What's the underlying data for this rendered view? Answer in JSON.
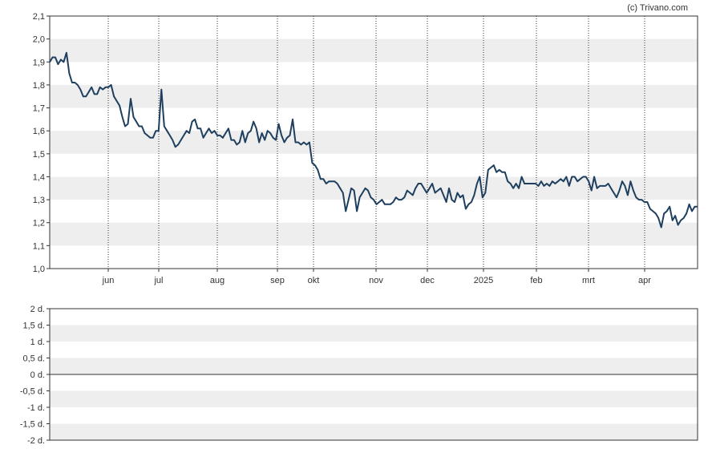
{
  "copyright": "(c) Trivano.com",
  "chart_data": [
    {
      "type": "line",
      "title": "",
      "xlabel": "",
      "ylabel": "",
      "ylim": [
        1.0,
        2.1
      ],
      "grid": "alternating horizontal bands, dotted vertical month lines",
      "line_color": "#1f3f5f",
      "band_color": "#eeeeee",
      "x_ticks": [
        "jun",
        "jul",
        "aug",
        "sep",
        "okt",
        "nov",
        "dec",
        "2025",
        "feb",
        "mrt",
        "apr"
      ],
      "y_ticks": [
        "1,0",
        "1,1",
        "1,2",
        "1,3",
        "1,4",
        "1,5",
        "1,6",
        "1,7",
        "1,8",
        "1,9",
        "2,0",
        "2,1"
      ],
      "series": [
        {
          "values": [
            1.9,
            1.92,
            1.92,
            1.89,
            1.91,
            1.9,
            1.94,
            1.85,
            1.81,
            1.81,
            1.8,
            1.78,
            1.75,
            1.75,
            1.77,
            1.79,
            1.76,
            1.76,
            1.79,
            1.78,
            1.79,
            1.79,
            1.8,
            1.75,
            1.73,
            1.71,
            1.66,
            1.62,
            1.63,
            1.74,
            1.66,
            1.64,
            1.62,
            1.62,
            1.59,
            1.58,
            1.57,
            1.57,
            1.6,
            1.6,
            1.78,
            1.62,
            1.6,
            1.58,
            1.56,
            1.53,
            1.54,
            1.56,
            1.58,
            1.6,
            1.59,
            1.64,
            1.65,
            1.61,
            1.61,
            1.57,
            1.59,
            1.61,
            1.59,
            1.6,
            1.58,
            1.58,
            1.57,
            1.59,
            1.61,
            1.56,
            1.56,
            1.54,
            1.55,
            1.6,
            1.55,
            1.59,
            1.6,
            1.64,
            1.61,
            1.55,
            1.59,
            1.56,
            1.6,
            1.59,
            1.57,
            1.56,
            1.63,
            1.58,
            1.55,
            1.57,
            1.58,
            1.65,
            1.55,
            1.55,
            1.54,
            1.55,
            1.54,
            1.55,
            1.46,
            1.45,
            1.43,
            1.39,
            1.39,
            1.37,
            1.38,
            1.38,
            1.38,
            1.37,
            1.35,
            1.33,
            1.25,
            1.3,
            1.35,
            1.34,
            1.25,
            1.31,
            1.33,
            1.35,
            1.34,
            1.31,
            1.3,
            1.28,
            1.29,
            1.3,
            1.28,
            1.28,
            1.28,
            1.29,
            1.31,
            1.3,
            1.3,
            1.31,
            1.34,
            1.33,
            1.32,
            1.35,
            1.37,
            1.37,
            1.35,
            1.33,
            1.35,
            1.37,
            1.33,
            1.34,
            1.35,
            1.32,
            1.29,
            1.35,
            1.3,
            1.29,
            1.33,
            1.31,
            1.32,
            1.26,
            1.28,
            1.29,
            1.32,
            1.37,
            1.4,
            1.31,
            1.33,
            1.43,
            1.44,
            1.45,
            1.42,
            1.43,
            1.42,
            1.42,
            1.38,
            1.37,
            1.35,
            1.37,
            1.35,
            1.4,
            1.37,
            1.37,
            1.37,
            1.37,
            1.37,
            1.36,
            1.38,
            1.36,
            1.37,
            1.36,
            1.38,
            1.37,
            1.38,
            1.39,
            1.38,
            1.4,
            1.36,
            1.4,
            1.4,
            1.38,
            1.39,
            1.4,
            1.4,
            1.38,
            1.34,
            1.4,
            1.35,
            1.36,
            1.36,
            1.36,
            1.37,
            1.35,
            1.33,
            1.31,
            1.34,
            1.38,
            1.36,
            1.32,
            1.38,
            1.34,
            1.31,
            1.3,
            1.3,
            1.29,
            1.29,
            1.26,
            1.25,
            1.24,
            1.22,
            1.18,
            1.24,
            1.25,
            1.27,
            1.21,
            1.23,
            1.19,
            1.21,
            1.22,
            1.24,
            1.28,
            1.25,
            1.27,
            1.27
          ]
        }
      ]
    },
    {
      "type": "line",
      "title": "",
      "ylim": [
        -2,
        2
      ],
      "grid": "alternating horizontal bands",
      "y_ticks": [
        "2 d.",
        "1,5 d.",
        "1 d.",
        "0,5 d.",
        "0 d.",
        "-0,5 d.",
        "-1 d.",
        "-1,5 d.",
        "-2 d."
      ],
      "series": []
    }
  ]
}
